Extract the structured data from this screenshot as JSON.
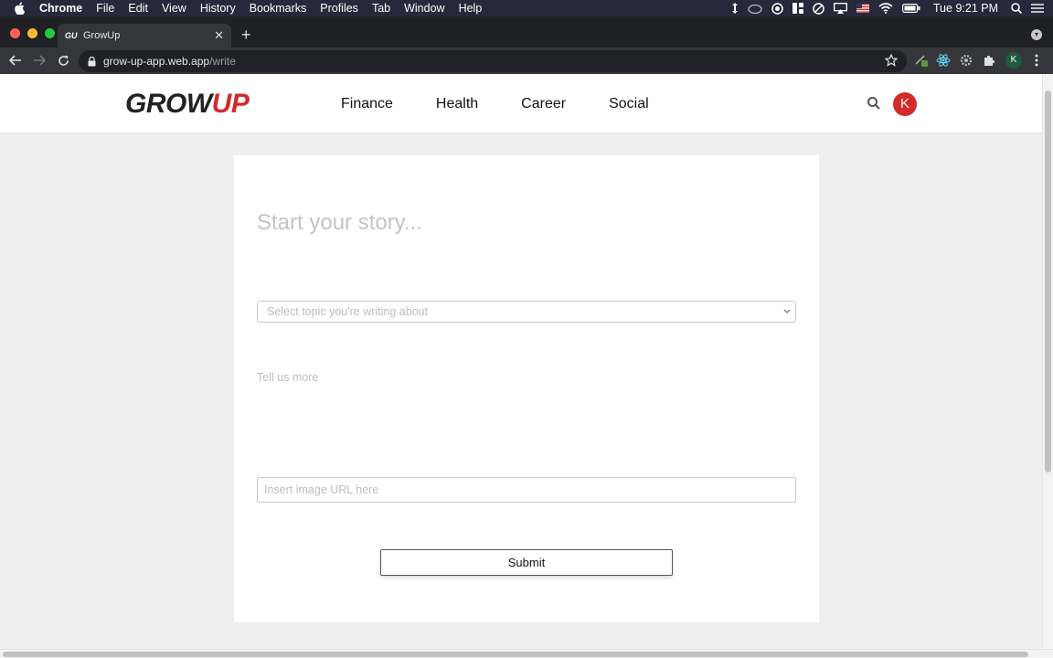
{
  "menubar": {
    "app": "Chrome",
    "items": [
      "File",
      "Edit",
      "View",
      "History",
      "Bookmarks",
      "Profiles",
      "Tab",
      "Window",
      "Help"
    ],
    "clock": "Tue 9:21 PM"
  },
  "browser": {
    "tab_title": "GrowUp",
    "tab_favicon": "GU",
    "url_host": "grow-up-app.web.app",
    "url_path": "/write",
    "profile_initial": "K"
  },
  "site": {
    "logo_part1": "GROW",
    "logo_part2": "UP",
    "nav": [
      "Finance",
      "Health",
      "Career",
      "Social"
    ],
    "avatar_initial": "K",
    "brand_color": "#d32a2a"
  },
  "form": {
    "title_placeholder": "Start your story...",
    "topic_placeholder": "Select topic you're writing about",
    "body_placeholder": "Tell us more",
    "image_placeholder": "Insert image URL here",
    "submit_label": "Submit"
  },
  "icons": {
    "search": "search-icon",
    "chevron": "chevron-down-icon",
    "lock": "lock-icon",
    "star": "bookmark-star-icon"
  }
}
